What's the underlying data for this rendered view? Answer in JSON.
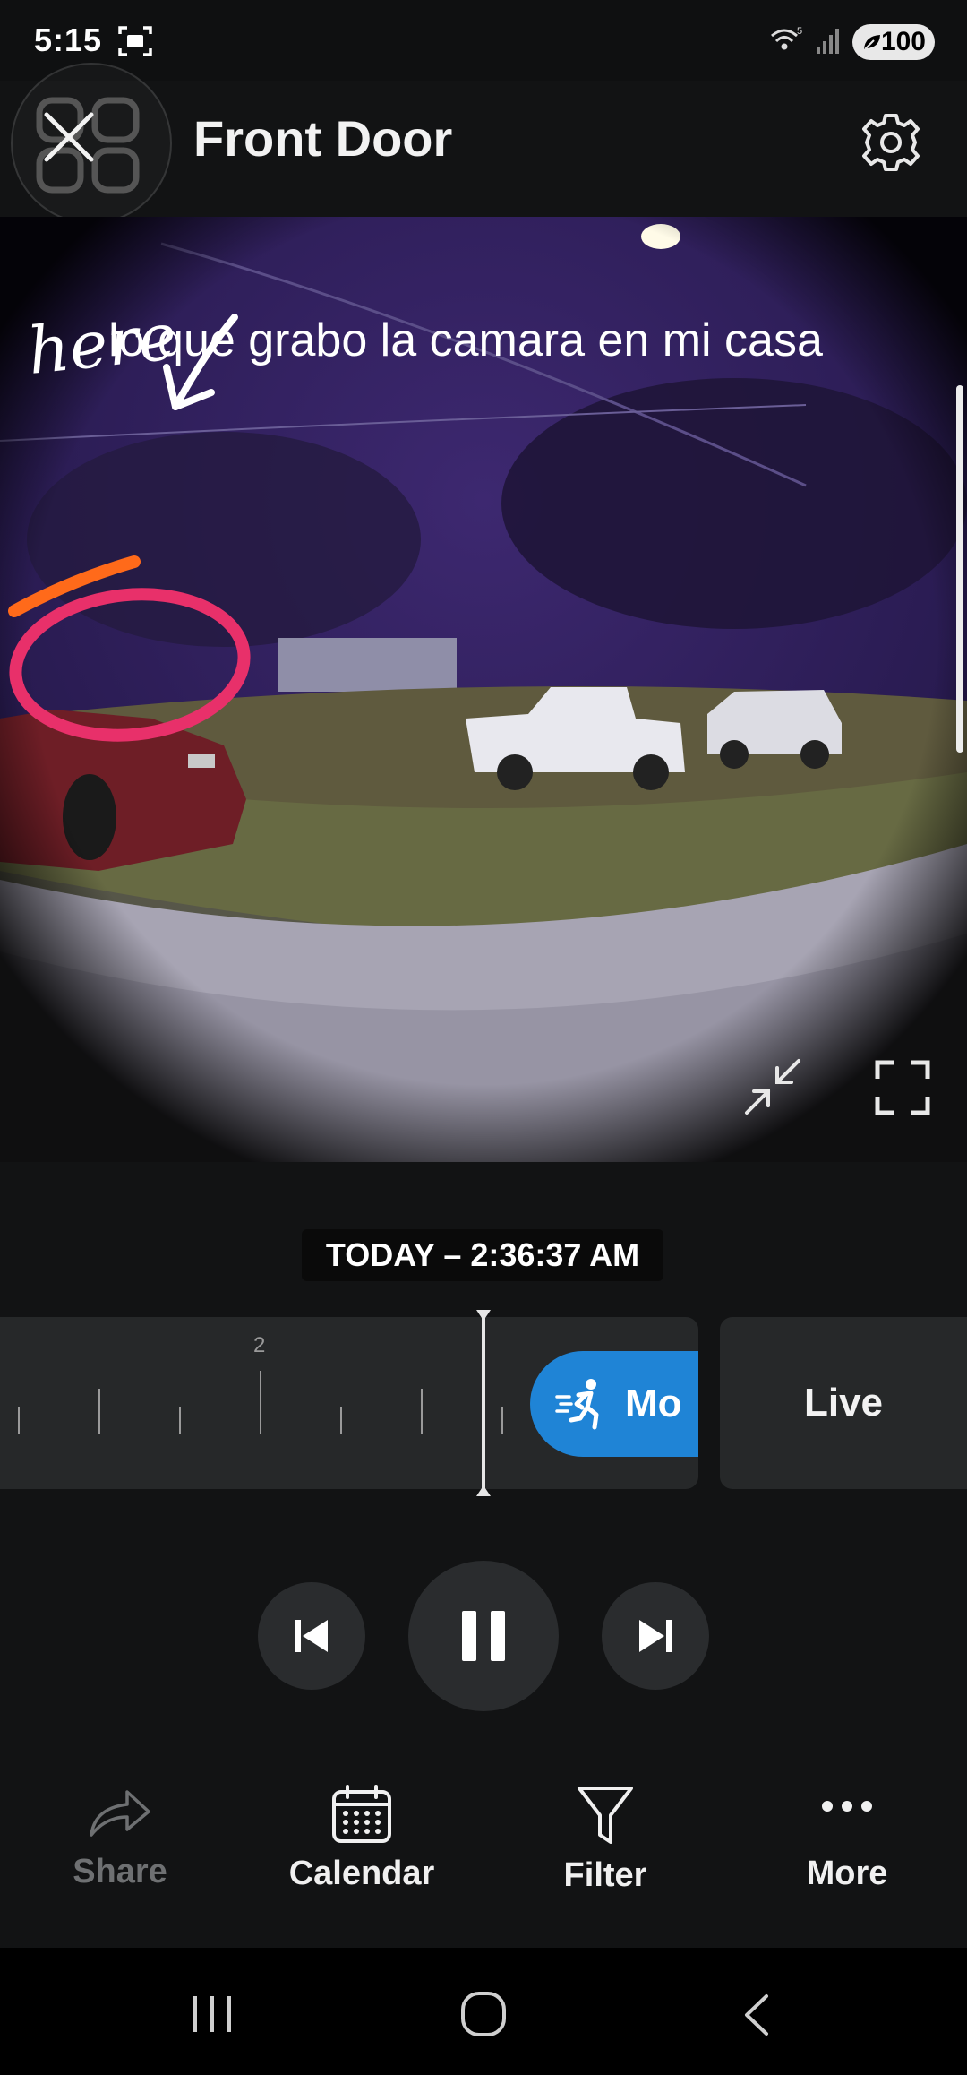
{
  "status_bar": {
    "time": "5:15",
    "network_badge": "5",
    "battery": "100"
  },
  "header": {
    "title": "Front Door"
  },
  "video": {
    "caption": "lo que grabo la camara en mi casa",
    "annotation": "here"
  },
  "playback": {
    "timestamp": "TODAY – 2:36:37 AM",
    "timeline_tick_label": "2",
    "event_chip_label": "Mo",
    "live_label": "Live"
  },
  "actions": {
    "share": "Share",
    "calendar": "Calendar",
    "filter": "Filter",
    "more": "More"
  },
  "colors": {
    "accent": "#1f84d6",
    "background": "#121314",
    "panel": "#262829",
    "disabled_text": "#6e7072"
  }
}
